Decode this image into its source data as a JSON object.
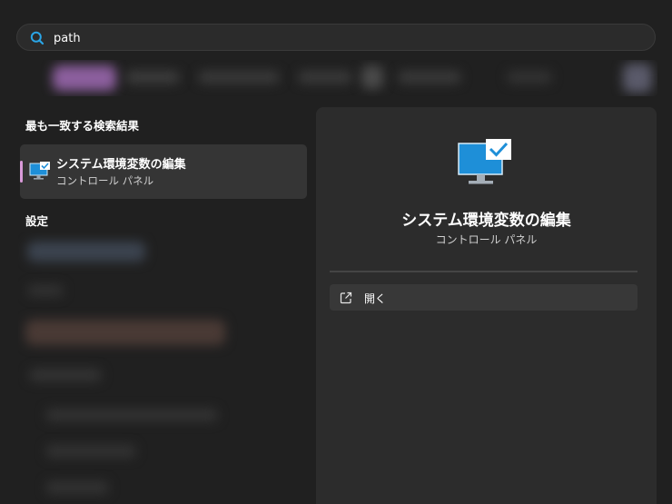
{
  "search": {
    "value": "path",
    "icon": "search-icon"
  },
  "results": {
    "best_match_heading": "最も一致する検索結果",
    "best_match": {
      "title": "システム環境変数の編集",
      "subtitle": "コントロール パネル",
      "icon": "monitor-check-icon"
    },
    "settings_heading": "設定"
  },
  "detail": {
    "title": "システム環境変数の編集",
    "subtitle": "コントロール パネル",
    "icon": "monitor-check-icon",
    "actions": [
      {
        "label": "開く",
        "icon": "open-external-icon"
      }
    ]
  },
  "colors": {
    "background": "#202020",
    "panel": "#2c2c2c",
    "selected_item": "#353535",
    "accent_bar": "#d99ad9",
    "monitor_blue": "#1e8fd8",
    "search_icon_blue": "#2aa5e6"
  }
}
